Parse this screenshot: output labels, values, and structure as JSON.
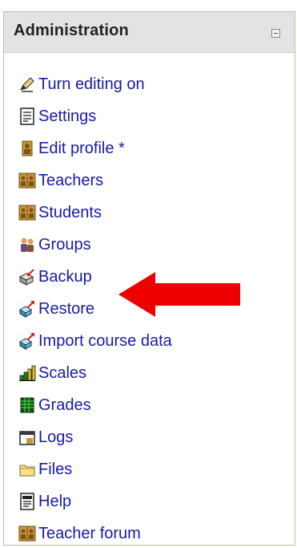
{
  "block": {
    "title": "Administration"
  },
  "items": [
    {
      "label": "Turn editing on",
      "icon": "pencil-icon"
    },
    {
      "label": "Settings",
      "icon": "settings-document-icon"
    },
    {
      "label": "Edit profile *",
      "icon": "profile-icon"
    },
    {
      "label": "Teachers",
      "icon": "teachers-icon"
    },
    {
      "label": "Students",
      "icon": "students-icon"
    },
    {
      "label": "Groups",
      "icon": "groups-icon"
    },
    {
      "label": "Backup",
      "icon": "backup-icon"
    },
    {
      "label": "Restore",
      "icon": "restore-icon"
    },
    {
      "label": "Import course data",
      "icon": "import-icon"
    },
    {
      "label": "Scales",
      "icon": "scales-icon"
    },
    {
      "label": "Grades",
      "icon": "grades-icon"
    },
    {
      "label": "Logs",
      "icon": "logs-icon"
    },
    {
      "label": "Files",
      "icon": "folder-icon"
    },
    {
      "label": "Help",
      "icon": "help-document-icon"
    },
    {
      "label": "Teacher forum",
      "icon": "forum-icon"
    }
  ],
  "annotation": {
    "color": "#ee0000"
  }
}
